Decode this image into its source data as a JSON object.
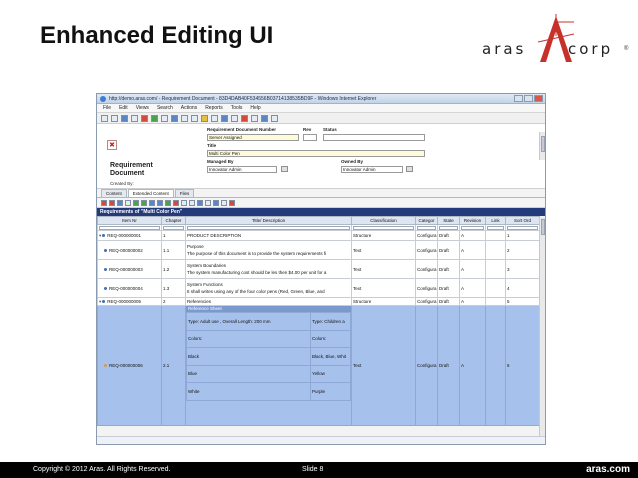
{
  "slide": {
    "title": "Enhanced Editing UI",
    "logo": {
      "left": "aras",
      "right": "corp",
      "registered": "®"
    },
    "footer": {
      "copyright": "Copyright © 2012 Aras.  All Rights Reserved.",
      "slide_no": "Slide 8",
      "url": "aras.com"
    }
  },
  "colors": {
    "selection": "#a6c2ec",
    "grid_header": "#233b7a",
    "logo_red": "#c8302a",
    "readonly_field": "#fdfbd8"
  },
  "window": {
    "title": "http://demo.aras.com/ - Requirement Document - 83D4DAB40F534556B03714138535BD9F - Windows Internet Explorer",
    "menu": [
      "File",
      "Edit",
      "Views",
      "Search",
      "Actions",
      "Reports",
      "Tools",
      "Help"
    ]
  },
  "form": {
    "doc_title_1": "Requirement",
    "doc_title_2": "Document",
    "created_by": "Created By:",
    "labels": {
      "number": "Requirement Document Number",
      "rev": "Rev",
      "status": "Status",
      "title": "Title",
      "managed_by": "Managed By",
      "owned_by": "Owned By"
    },
    "values": {
      "number": "Server Assigned",
      "title": "Multi Color Pen",
      "managed_by": "Innovator Admin",
      "owned_by": "Innovator Admin"
    }
  },
  "tabs": [
    "Content",
    "Extended Content",
    "Files"
  ],
  "grid": {
    "title": "Requirements of \"Multi Color Pen\"",
    "columns": [
      "Item Nr",
      "Chapter",
      "Title/ Description",
      "Classification",
      "Categor",
      "State",
      "Revision",
      "Link",
      "Sort Ord"
    ],
    "rows": [
      {
        "item": "REQ-000000001",
        "chapter": "1",
        "title": "PRODUCT DESCRIPTION",
        "desc": "",
        "class": "Structure",
        "cat": "Configura",
        "state": "Draft",
        "rev": "A",
        "sort": "1",
        "kind": "parent"
      },
      {
        "item": "REQ-000000002",
        "chapter": "1.1",
        "title": "Purpose",
        "desc": "The purpose of this document is to provide the system requirements fi",
        "class": "Text",
        "cat": "Configura",
        "state": "Draft",
        "rev": "A",
        "sort": "2",
        "kind": "child"
      },
      {
        "item": "REQ-000000003",
        "chapter": "1.2",
        "title": "System Boundaries",
        "desc": "The system manufacturing cost should be les then $4.00 per unit for a",
        "class": "Text",
        "cat": "Configura",
        "state": "Draft",
        "rev": "A",
        "sort": "3",
        "kind": "child"
      },
      {
        "item": "REQ-000000004",
        "chapter": "1.3",
        "title": "System Functions",
        "desc": " It shall writes using any of the four color pens (Red, Green, Blue, and",
        "class": "Text",
        "cat": "Configura",
        "state": "Draft",
        "rev": "A",
        "sort": "4",
        "kind": "child"
      },
      {
        "item": "REQ-000000005",
        "chapter": "2",
        "title": "Referencies",
        "desc": "",
        "class": "Structure",
        "cat": "Configura",
        "state": "Draft",
        "rev": "A",
        "sort": "5",
        "kind": "parent"
      }
    ],
    "selected": {
      "item": "REQ-000000006",
      "chapter": "2.1",
      "class": "Text",
      "cat": "Configura",
      "state": "Draft",
      "rev": "A",
      "sort": "6",
      "sheet_title": "Reference Sheet",
      "sheet": [
        [
          "Type: Adult use ,  Overall Length: 200 mm",
          "Type: Children a"
        ],
        [
          "Colors:",
          "Colors:"
        ],
        [
          "Black",
          "Black, Blue, Whit"
        ],
        [
          "Blue",
          "Yellow"
        ],
        [
          "White",
          "Purple"
        ]
      ]
    }
  }
}
